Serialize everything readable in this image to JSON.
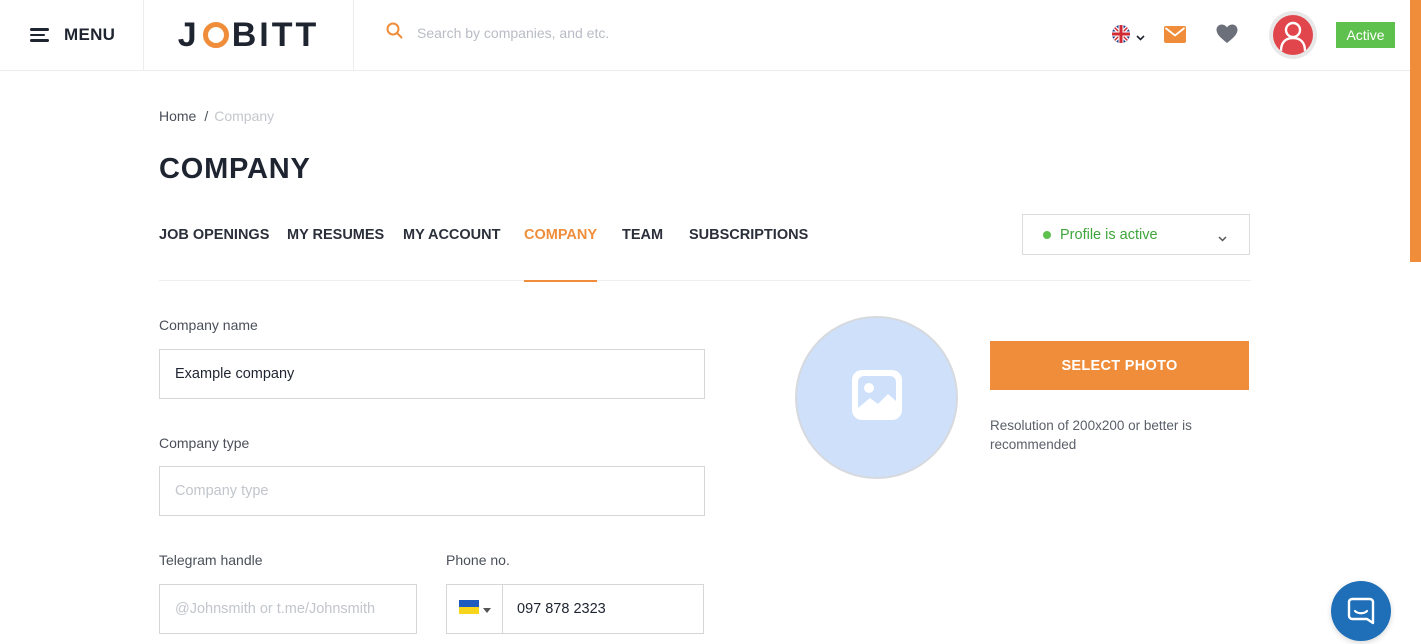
{
  "header": {
    "menu_label": "MENU",
    "logo_text_1": "J",
    "logo_text_2": "BITT",
    "search_placeholder": "Search by companies, and etc.",
    "status_badge": "Active"
  },
  "breadcrumb": {
    "home": "Home",
    "separator": "/",
    "current": "Company"
  },
  "page_title": "COMPANY",
  "tabs": [
    {
      "label": "JOB OPENINGS",
      "active": false
    },
    {
      "label": "MY RESUMES",
      "active": false
    },
    {
      "label": "MY ACCOUNT",
      "active": false
    },
    {
      "label": "COMPANY",
      "active": true
    },
    {
      "label": "TEAM",
      "active": false
    },
    {
      "label": "SUBSCRIPTIONS",
      "active": false
    }
  ],
  "profile_status": {
    "label": "Profile is active"
  },
  "form": {
    "company_name": {
      "label": "Company name",
      "value": "Example company",
      "placeholder": ""
    },
    "company_type": {
      "label": "Company type",
      "value": "",
      "placeholder": "Company type"
    },
    "telegram": {
      "label": "Telegram handle",
      "value": "",
      "placeholder": "@Johnsmith or t.me/Johnsmith"
    },
    "phone": {
      "label": "Phone no.",
      "value": "097 878 2323",
      "country_flag": "ukraine-flag"
    }
  },
  "photo": {
    "button_label": "SELECT PHOTO",
    "hint": "Resolution of 200x200 or better is recommended"
  },
  "colors": {
    "accent": "#f08d3a",
    "active_green": "#5ec14d",
    "chat_blue": "#1f6fb8",
    "photo_placeholder": "#cfe0fb"
  },
  "icons": {
    "search": "search-icon",
    "language": "uk-flag-icon",
    "mail": "mail-icon",
    "favorites": "heart-icon",
    "avatar": "user-avatar-icon",
    "photo_placeholder": "image-icon",
    "chat": "chat-icon"
  }
}
